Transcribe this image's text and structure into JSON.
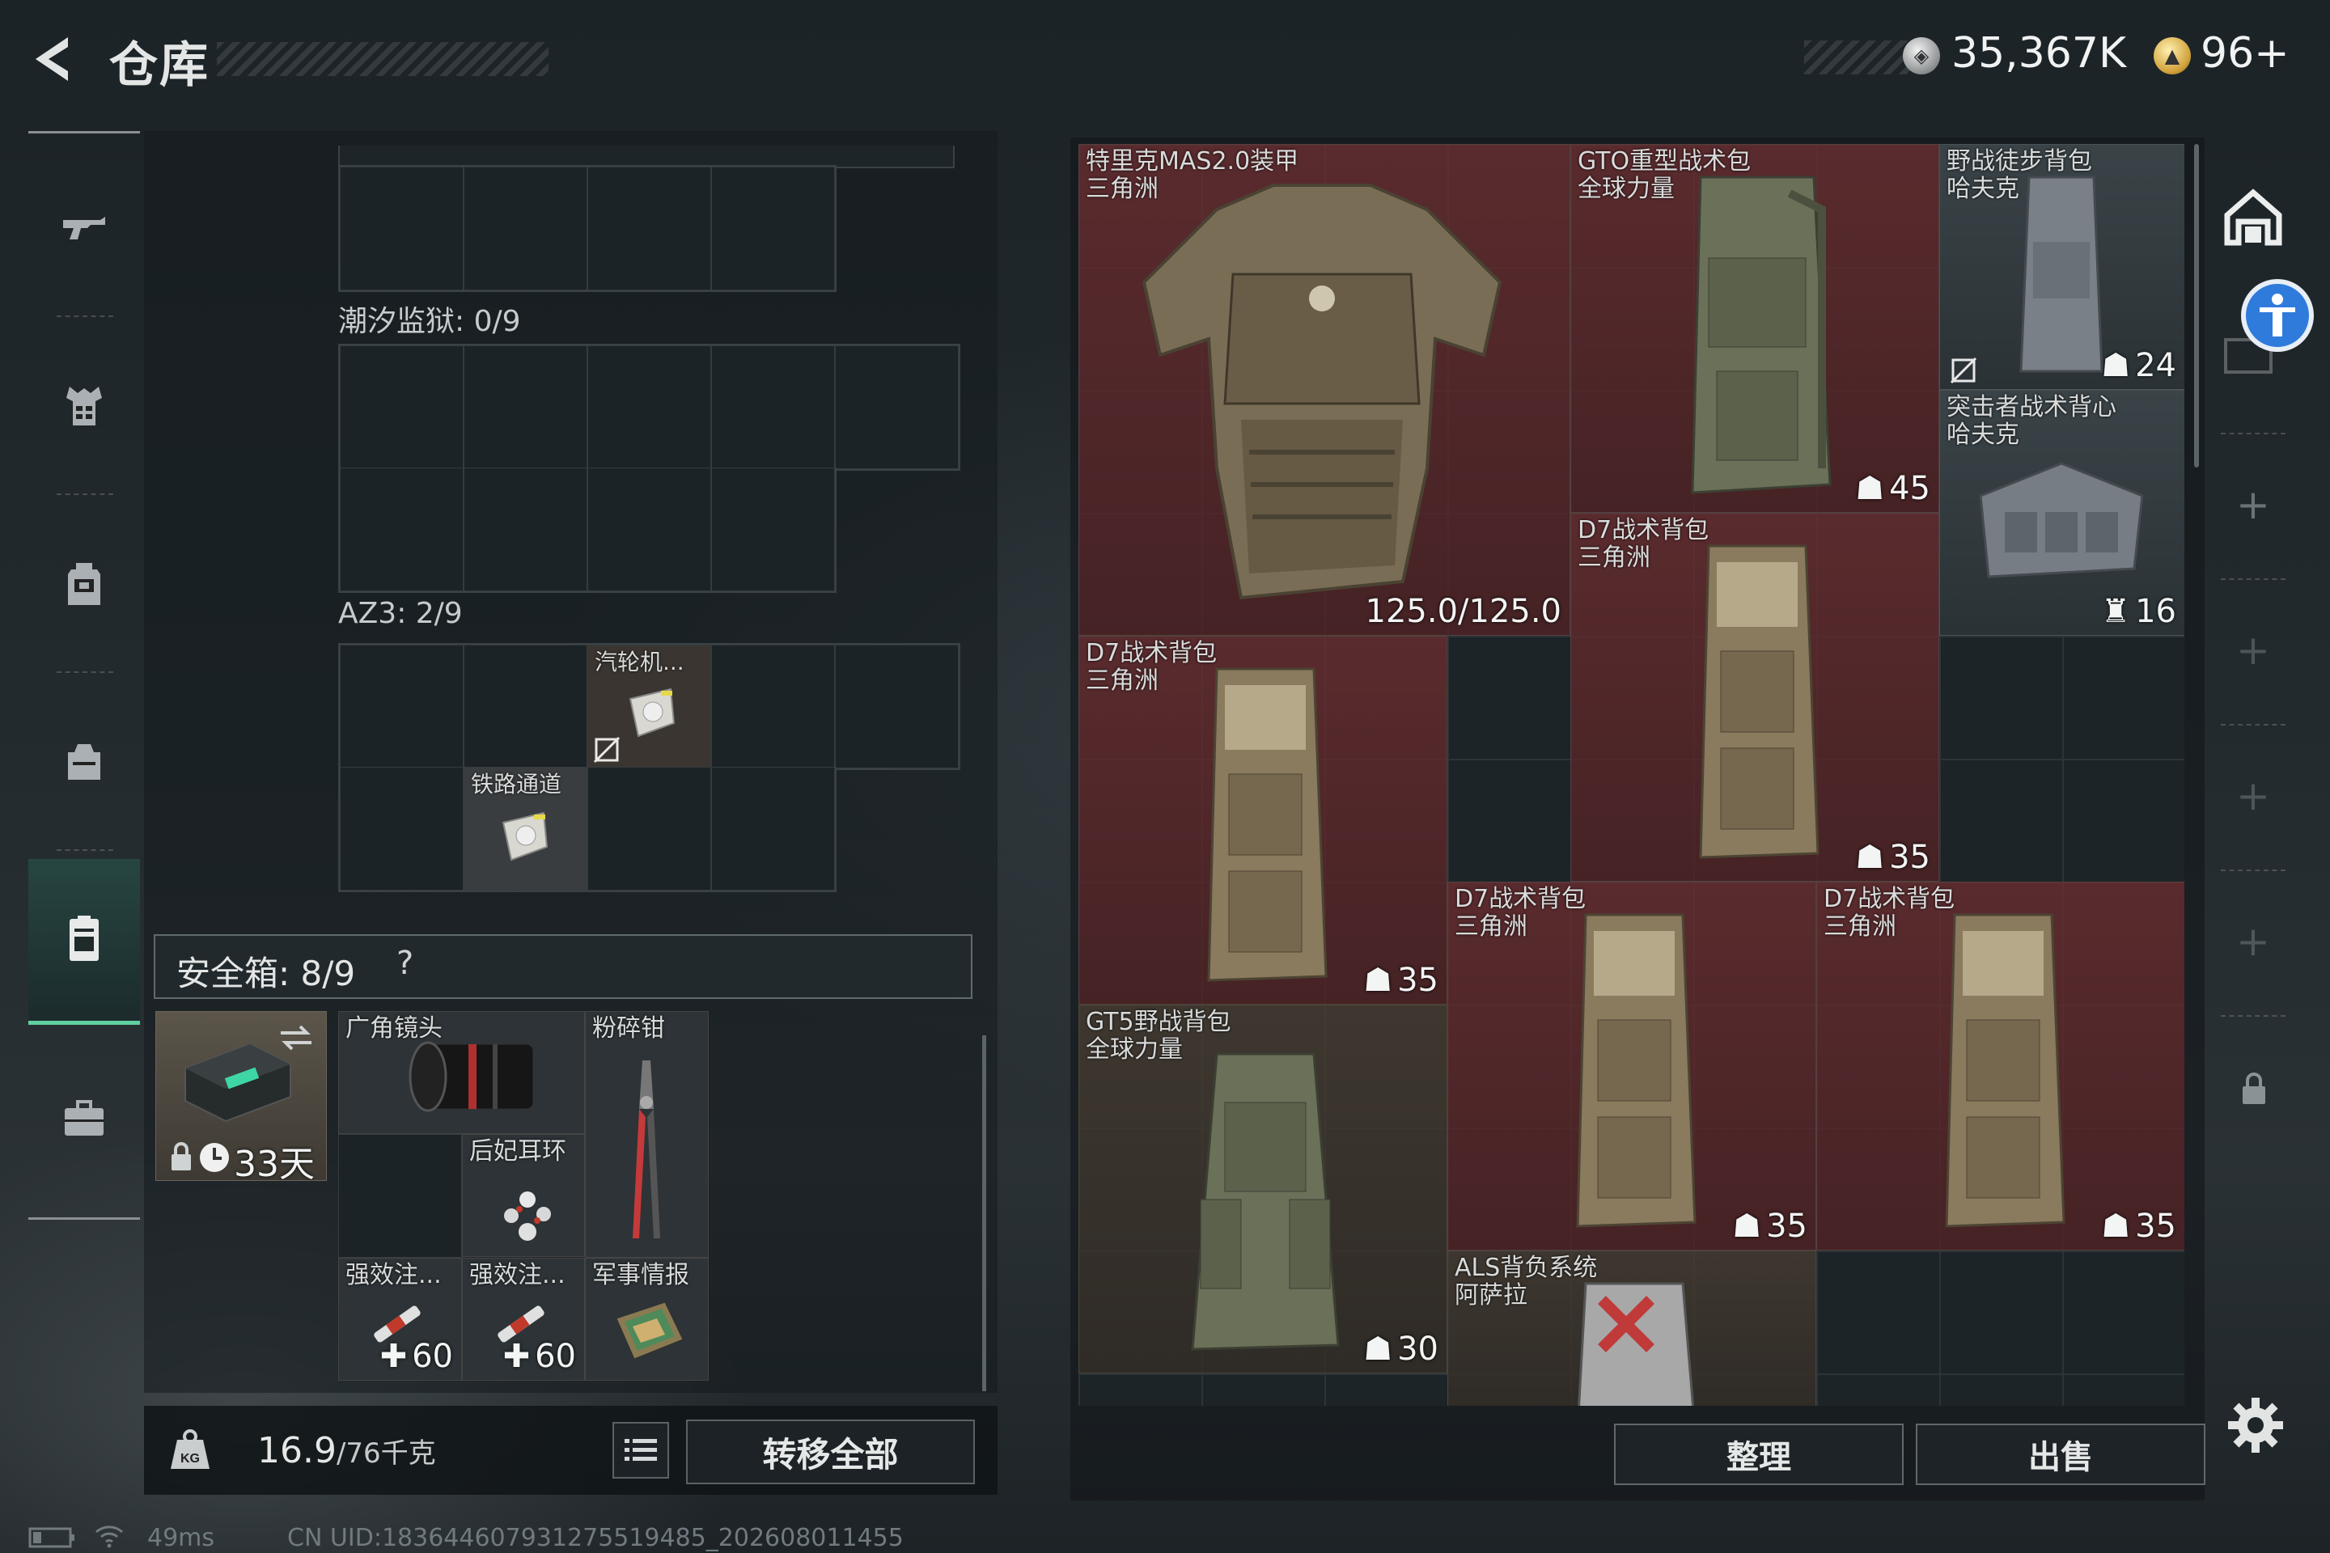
{
  "header": {
    "title": "仓库",
    "currency_silver": "35,367K",
    "currency_gold": "96+"
  },
  "nav": {
    "items": [
      {
        "name": "weapon"
      },
      {
        "name": "armor"
      },
      {
        "name": "backpack"
      },
      {
        "name": "bag"
      },
      {
        "name": "case"
      },
      {
        "name": "briefcase"
      }
    ]
  },
  "left": {
    "tidal_prison": "潮汐监狱: 0/9",
    "az3": "AZ3: 2/9",
    "az3_items": [
      {
        "name": "汽轮机..."
      },
      {
        "name": "铁路通道"
      }
    ],
    "safe_box": {
      "label": "安全箱: 8/9",
      "help": "?",
      "days": "33天",
      "items": {
        "wide_lens": "广角镜头",
        "crusher": "粉碎钳",
        "earring": "后妃耳环",
        "injector1": "强效注...",
        "injector1_val": "60",
        "injector2": "强效注...",
        "injector2_val": "60",
        "intel": "军事情报"
      }
    },
    "weight_value": "16.9",
    "weight_total": "/76千克",
    "transfer_all": "转移全部"
  },
  "status": {
    "ping": "49ms",
    "uid": "CN UID:1836446079312755194​85_202608011455"
  },
  "right": {
    "items": [
      {
        "name": "特里克MAS2.0装甲",
        "sub": "三角洲",
        "value": "125.0/125.0"
      },
      {
        "name": "GTO重型战术包",
        "sub": "全球力量",
        "value": "45"
      },
      {
        "name": "野战徒步背包",
        "sub": "哈夫克",
        "value": "24"
      },
      {
        "name": "突击者战术背心",
        "sub": "哈夫克",
        "value": "16"
      },
      {
        "name": "D7战术背包",
        "sub": "三角洲",
        "value": "35"
      },
      {
        "name": "D7战术背包",
        "sub": "三角洲",
        "value": "35"
      },
      {
        "name": "D7战术背包",
        "sub": "三角洲",
        "value": "35"
      },
      {
        "name": "D7战术背包",
        "sub": "三角洲",
        "value": "35"
      },
      {
        "name": "GT5野战背包",
        "sub": "全球力量",
        "value": "30"
      },
      {
        "name": "ALS背负系统",
        "sub": "阿萨拉"
      }
    ],
    "sort": "整理",
    "sell": "出售"
  },
  "colors": {
    "accent_green": "#5fd0a0",
    "item_red": "#6e2d30",
    "a11y_blue": "#2f7bdc"
  }
}
